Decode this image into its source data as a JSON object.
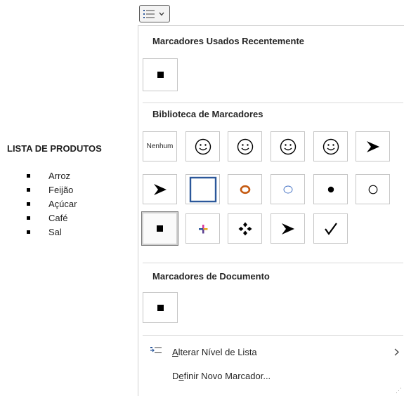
{
  "document": {
    "title": "LISTA DE PRODUTOS",
    "items": [
      "Arroz",
      "Feijão",
      "Açúcar",
      "Café",
      "Sal"
    ]
  },
  "toolbar": {
    "bullets_button_icon": "bullet-list-icon",
    "dropdown_icon": "chevron-down-icon"
  },
  "dropdown": {
    "recent_title": "Marcadores Usados Recentemente",
    "library_title": "Biblioteca de Marcadores",
    "document_title": "Marcadores de Documento",
    "none_label": "Nenhum",
    "library_selected": "black-square",
    "library_bullets": [
      "none",
      "smiley",
      "smiley",
      "smiley",
      "smiley",
      "arrowhead",
      "arrowhead",
      "blue-square-outline",
      "orange-ring",
      "light-blue-circle",
      "black-dot",
      "white-circle",
      "black-square",
      "color-cross",
      "four-diamonds",
      "arrowhead",
      "checkmark"
    ],
    "change_level_prefix": "A",
    "change_level_rest": "lterar Nível de Lista",
    "define_new_prefix": "D",
    "define_new_mid": "e",
    "define_new_rest": "finir Novo Marcador..."
  },
  "colors": {
    "accent_blue": "#2b579a",
    "orange": "#c55a11",
    "light_blue": "#4472c4"
  }
}
